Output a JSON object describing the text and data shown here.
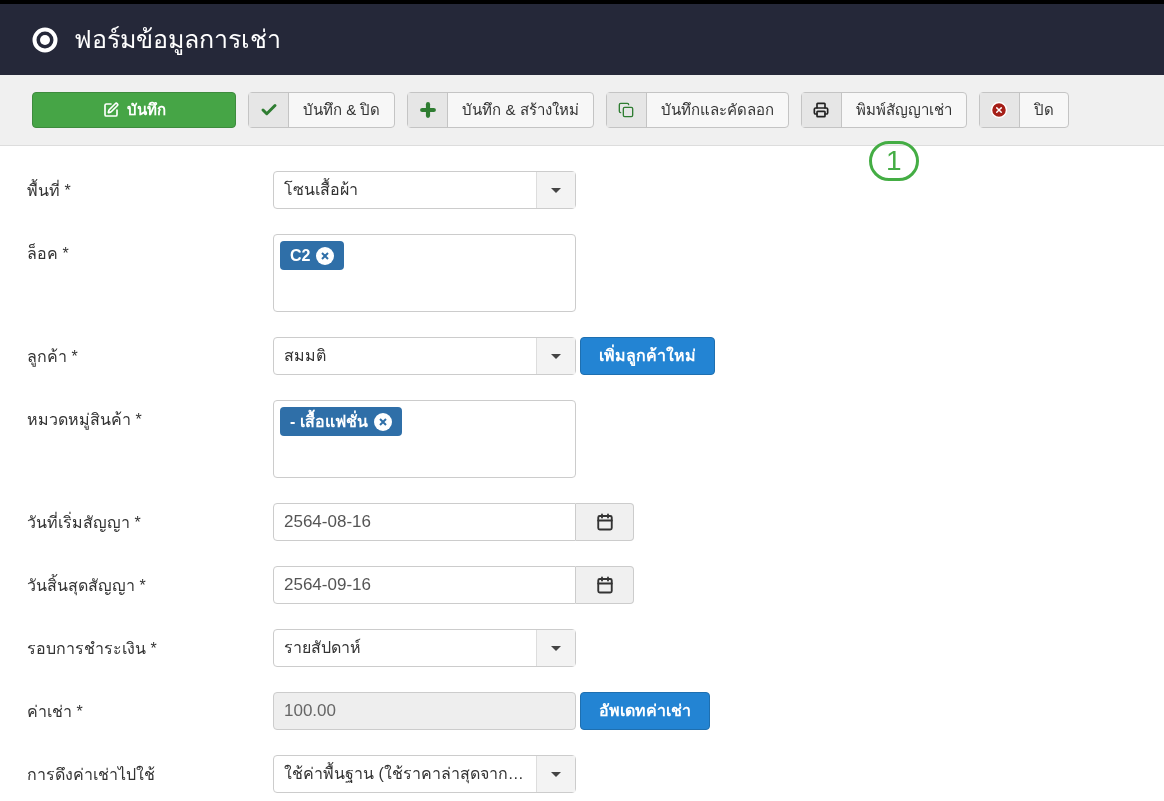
{
  "header": {
    "title": "ฟอร์มข้อมูลการเช่า"
  },
  "toolbar": [
    {
      "kind": "primary",
      "label": "บันทึก"
    },
    {
      "kind": "default",
      "label": "บันทึก & ปิด"
    },
    {
      "kind": "default",
      "label": "บันทึก & สร้างใหม่"
    },
    {
      "kind": "default",
      "label": "บันทึกและคัดลอก"
    },
    {
      "kind": "default",
      "label": "พิมพ์สัญญาเช่า",
      "annotation": "1"
    },
    {
      "kind": "default",
      "label": "ปิด"
    }
  ],
  "fields": [
    {
      "label": "พื้นที่ *",
      "kind": "select",
      "value": "โซนเสื้อผ้า"
    },
    {
      "label": "ล็อค *",
      "kind": "tags",
      "tags": [
        "C2"
      ]
    },
    {
      "label": "ลูกค้า *",
      "kind": "select",
      "value": "สมมติ",
      "button": "เพิ่มลูกค้าใหม่"
    },
    {
      "label": "หมวดหมู่สินค้า *",
      "kind": "tags",
      "tags": [
        "- เสื้อแฟชั่น"
      ]
    },
    {
      "label": "วันที่เริ่มสัญญา *",
      "kind": "date",
      "value": "2564-08-16"
    },
    {
      "label": "วันสิ้นสุดสัญญา *",
      "kind": "date",
      "value": "2564-09-16"
    },
    {
      "label": "รอบการชำระเงิน *",
      "kind": "select",
      "value": "รายสัปดาห์"
    },
    {
      "label": "ค่าเช่า *",
      "kind": "text",
      "value": "100.00",
      "disabled": true,
      "button": "อัพเดทค่าเช่า"
    },
    {
      "label": "การดึงค่าเช่าไปใช้",
      "kind": "select",
      "value": "ใช้ค่าพื้นฐาน (ใช้ราคาล่าสุดจาก…"
    }
  ]
}
